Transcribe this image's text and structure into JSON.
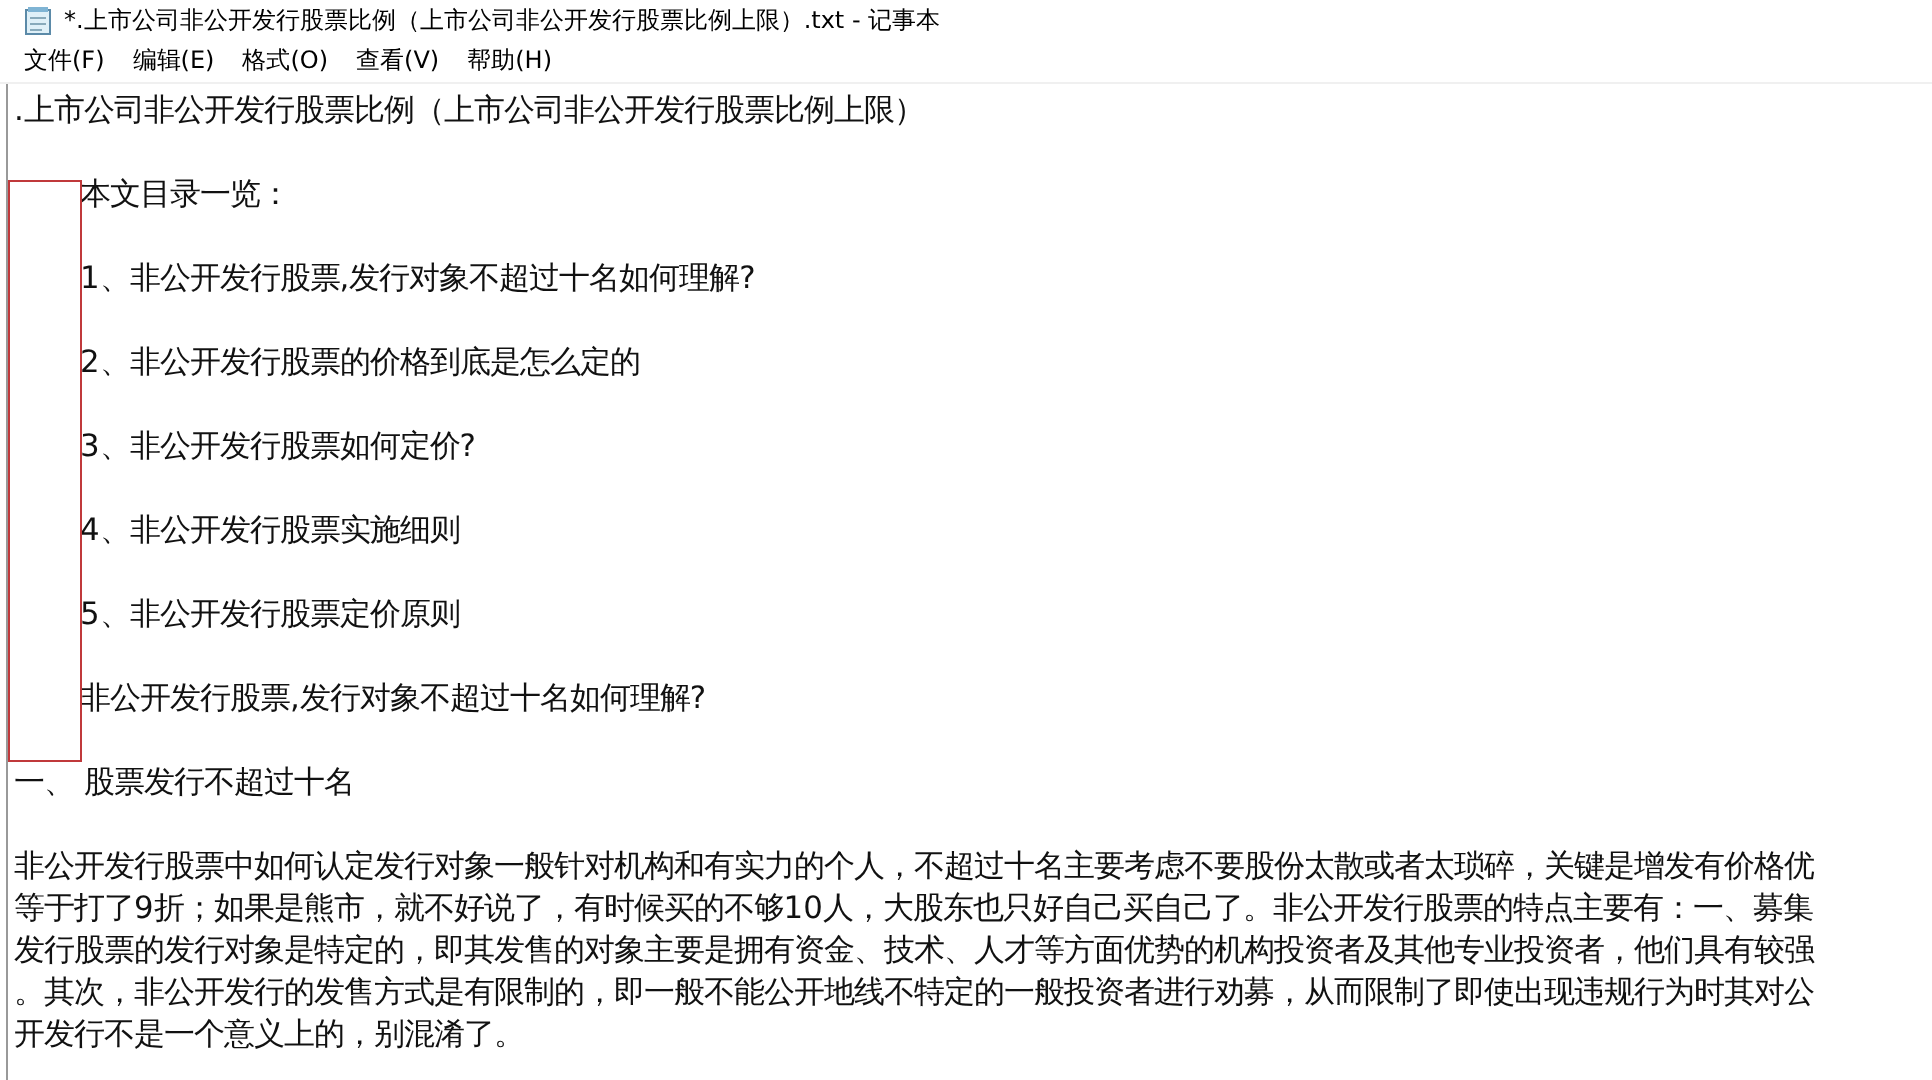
{
  "window": {
    "title": "*.上市公司非公开发行股票比例（上市公司非公开发行股票比例上限）.txt - 记事本"
  },
  "menu": [
    "文件(F)",
    "编辑(E)",
    "格式(O)",
    "查看(V)",
    "帮助(H)"
  ],
  "document": {
    "lines": [
      {
        "kind": "plain",
        "text": ".上市公司非公开发行股票比例（上市公司非公开发行股票比例上限）"
      },
      {
        "kind": "indented",
        "text": "本文目录一览："
      },
      {
        "kind": "indented",
        "text": "1、非公开发行股票,发行对象不超过十名如何理解?"
      },
      {
        "kind": "indented",
        "text": "2、非公开发行股票的价格到底是怎么定的"
      },
      {
        "kind": "indented",
        "text": "3、非公开发行股票如何定价?"
      },
      {
        "kind": "indented",
        "text": "4、非公开发行股票实施细则"
      },
      {
        "kind": "indented",
        "text": "5、非公开发行股票定价原则"
      },
      {
        "kind": "indented",
        "text": "非公开发行股票,发行对象不超过十名如何理解?"
      },
      {
        "kind": "plain",
        "text": "一、 股票发行不超过十名"
      }
    ],
    "paragraph": [
      "非公开发行股票中如何认定发行对象一般针对机构和有实力的个人，不超过十名主要考虑不要股份太散或者太琐碎，关键是增发有价格优",
      "等于打了9折；如果是熊市，就不好说了，有时候买的不够10人，大股东也只好自己买自己了。非公开发行股票的特点主要有：一、募集",
      "发行股票的发行对象是特定的，即其发售的对象主要是拥有资金、技术、人才等方面优势的机构投资者及其他专业投资者，他们具有较强",
      "。其次，非公开发行的发售方式是有限制的，即一般不能公开地线不特定的一般投资者进行劝募，从而限制了即使出现违规行为时其对公",
      "开发行不是一个意义上的，别混淆了。"
    ]
  }
}
